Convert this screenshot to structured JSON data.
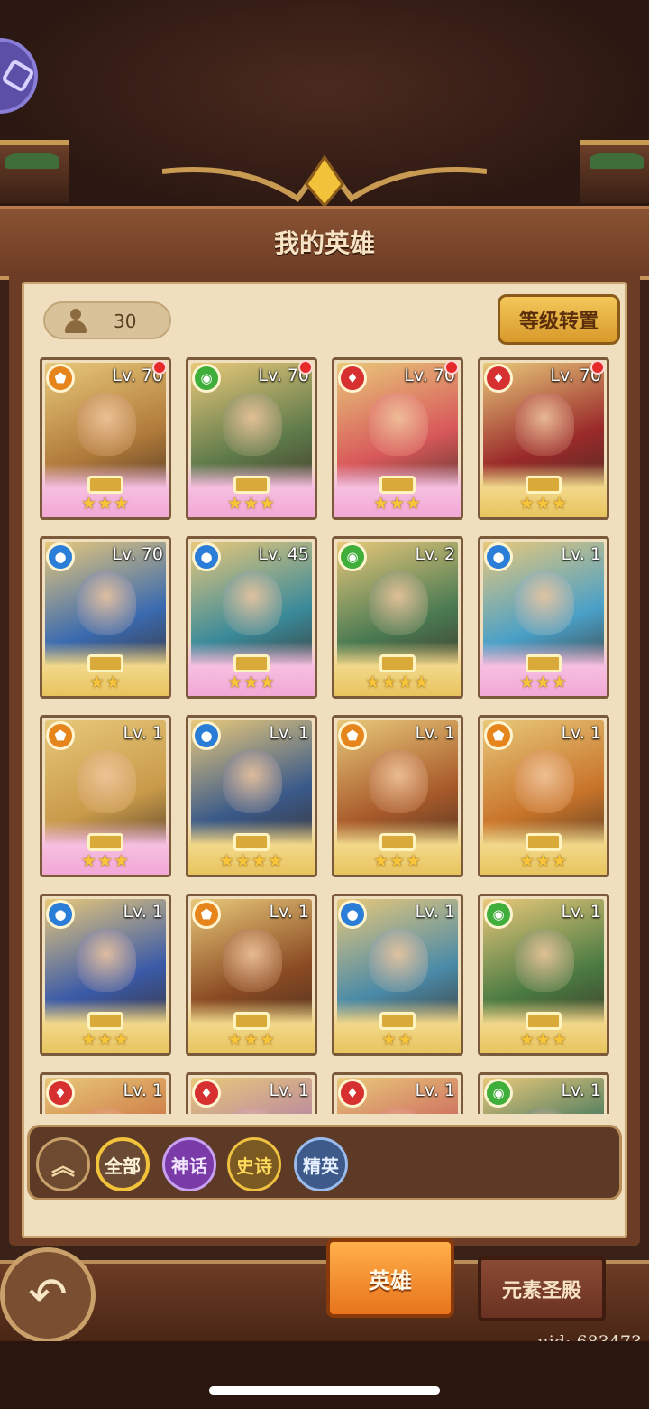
{
  "header": {
    "title": "我的英雄"
  },
  "hero_count": "30",
  "reset_button": "等级转置",
  "heroes": [
    {
      "level": "Lv. 70",
      "element": "earth",
      "stars": "★★★",
      "rarity": "pink",
      "new": true,
      "color": "#b07a3a"
    },
    {
      "level": "Lv. 70",
      "element": "nature",
      "stars": "★★★",
      "rarity": "pink",
      "new": true,
      "color": "#5e7a4a"
    },
    {
      "level": "Lv. 70",
      "element": "fire",
      "stars": "★★★",
      "rarity": "pink",
      "new": true,
      "color": "#d8585a"
    },
    {
      "level": "Lv. 70",
      "element": "fire",
      "stars": "★★★",
      "rarity": "gold",
      "new": true,
      "color": "#9a2a2a"
    },
    {
      "level": "Lv. 70",
      "element": "water",
      "stars": "★★",
      "rarity": "gold",
      "new": false,
      "color": "#3a6ab0"
    },
    {
      "level": "Lv. 45",
      "element": "water",
      "stars": "★★★",
      "rarity": "pink",
      "new": false,
      "color": "#3a8a9a"
    },
    {
      "level": "Lv. 2",
      "element": "nature",
      "stars": "★★★★",
      "rarity": "gold",
      "new": false,
      "color": "#4a7a52"
    },
    {
      "level": "Lv. 1",
      "element": "water",
      "stars": "★★★",
      "rarity": "pink",
      "new": false,
      "color": "#4aa0c8"
    },
    {
      "level": "Lv. 1",
      "element": "earth",
      "stars": "★★★",
      "rarity": "pink",
      "new": false,
      "color": "#c89a4a"
    },
    {
      "level": "Lv. 1",
      "element": "water",
      "stars": "★★★★",
      "rarity": "gold",
      "new": false,
      "color": "#3a5a8a"
    },
    {
      "level": "Lv. 1",
      "element": "earth",
      "stars": "★★★",
      "rarity": "gold",
      "new": false,
      "color": "#a85a2a"
    },
    {
      "level": "Lv. 1",
      "element": "earth",
      "stars": "★★★",
      "rarity": "gold",
      "new": false,
      "color": "#c8742a"
    },
    {
      "level": "Lv. 1",
      "element": "water",
      "stars": "★★★",
      "rarity": "gold",
      "new": false,
      "color": "#3a5aa8"
    },
    {
      "level": "Lv. 1",
      "element": "earth",
      "stars": "★★★",
      "rarity": "gold",
      "new": false,
      "color": "#8a4a22"
    },
    {
      "level": "Lv. 1",
      "element": "water",
      "stars": "★★",
      "rarity": "gold",
      "new": false,
      "color": "#4a8aa8"
    },
    {
      "level": "Lv. 1",
      "element": "nature",
      "stars": "★★★",
      "rarity": "gold",
      "new": false,
      "color": "#4a7a42"
    },
    {
      "level": "Lv. 1",
      "element": "fire",
      "stars": "",
      "rarity": "gold",
      "new": false,
      "color": "#c86a3a"
    },
    {
      "level": "Lv. 1",
      "element": "fire",
      "stars": "",
      "rarity": "gold",
      "new": false,
      "color": "#b07aa8"
    },
    {
      "level": "Lv. 1",
      "element": "fire",
      "stars": "",
      "rarity": "gold",
      "new": false,
      "color": "#c85a5a"
    },
    {
      "level": "Lv. 1",
      "element": "nature",
      "stars": "",
      "rarity": "gold",
      "new": false,
      "color": "#2a6a5a"
    }
  ],
  "filters": {
    "collapse_icon": "double-chevron-up-icon",
    "all": "全部",
    "myth": "神话",
    "epic": "史诗",
    "elite": "精英"
  },
  "bottom": {
    "back_icon": "back-arrow-icon",
    "tab_heroes": "英雄",
    "tab_shrine": "元素圣殿",
    "uid": "uid: 683473"
  },
  "colors": {
    "fire": "#d63030",
    "earth": "#e6851c",
    "nature": "#3fae3a",
    "water": "#2a7ed8"
  }
}
